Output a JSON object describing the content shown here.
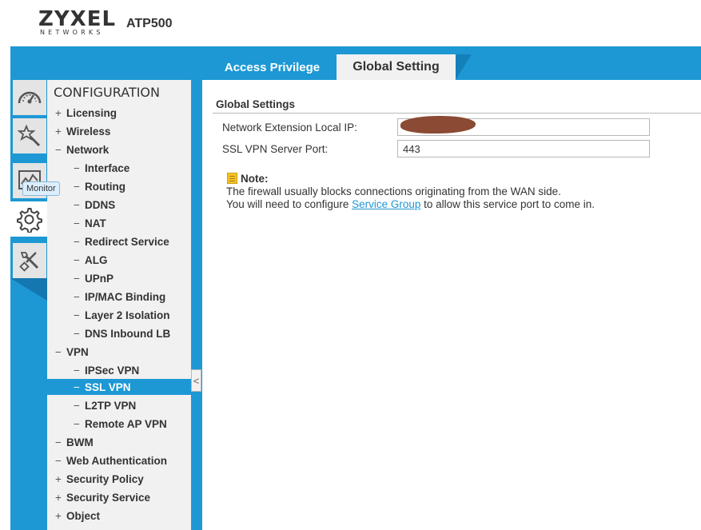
{
  "header": {
    "brand": "ZYXEL",
    "brand_sub": "NETWORKS",
    "model": "ATP500"
  },
  "tabs": [
    {
      "label": "Access Privilege",
      "active": false
    },
    {
      "label": "Global Setting",
      "active": true
    }
  ],
  "rail": {
    "items": [
      {
        "icon": "dashboard-gauge-icon"
      },
      {
        "icon": "quick-setup-wand-icon"
      },
      {
        "icon": "monitor-chart-icon"
      },
      {
        "icon": "configuration-gear-icon",
        "active": true
      },
      {
        "icon": "maintenance-tools-icon"
      }
    ],
    "tooltip": "Monitor"
  },
  "menu": {
    "title": "CONFIGURATION",
    "items": [
      {
        "sign": "+",
        "label": "Licensing"
      },
      {
        "sign": "+",
        "label": "Wireless"
      },
      {
        "sign": "−",
        "label": "Network"
      },
      {
        "sign": "−",
        "label": "Interface"
      },
      {
        "sign": "−",
        "label": "Routing"
      },
      {
        "sign": "−",
        "label": "DDNS"
      },
      {
        "sign": "−",
        "label": "NAT"
      },
      {
        "sign": "−",
        "label": "Redirect Service"
      },
      {
        "sign": "−",
        "label": "ALG"
      },
      {
        "sign": "−",
        "label": "UPnP"
      },
      {
        "sign": "−",
        "label": "IP/MAC Binding"
      },
      {
        "sign": "−",
        "label": "Layer 2 Isolation"
      },
      {
        "sign": "−",
        "label": "DNS Inbound LB"
      },
      {
        "sign": "−",
        "label": "VPN"
      },
      {
        "sign": "−",
        "label": "IPSec VPN"
      },
      {
        "sign": "−",
        "label": "SSL VPN",
        "selected": true
      },
      {
        "sign": "−",
        "label": "L2TP VPN"
      },
      {
        "sign": "−",
        "label": "Remote AP VPN"
      },
      {
        "sign": "−",
        "label": "BWM"
      },
      {
        "sign": "−",
        "label": "Web Authentication"
      },
      {
        "sign": "+",
        "label": "Security Policy"
      },
      {
        "sign": "+",
        "label": "Security Service"
      },
      {
        "sign": "+",
        "label": "Object"
      }
    ],
    "collapse_glyph": "<"
  },
  "content": {
    "section_title": "Global Settings",
    "fields": [
      {
        "label": "Network Extension Local IP:",
        "value": ""
      },
      {
        "label": "SSL VPN Server Port:",
        "value": "443"
      }
    ],
    "note": {
      "title": "Note:",
      "line1": "The firewall usually blocks connections originating from the WAN side.",
      "line2_before": "You will need to configure ",
      "line2_link": "Service Group",
      "line2_after": " to allow this service port to come in."
    }
  },
  "colors": {
    "band": "#1d98d4",
    "menu_bg": "#f1f1f1",
    "selected": "#1d98d4",
    "link": "#1d98d4"
  }
}
